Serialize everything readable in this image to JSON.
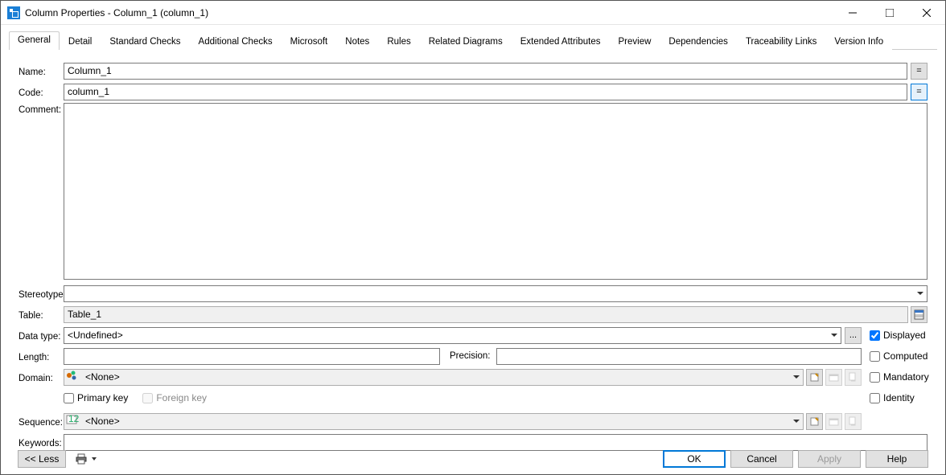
{
  "window": {
    "title": "Column Properties - Column_1 (column_1)"
  },
  "tabs": [
    "General",
    "Detail",
    "Standard Checks",
    "Additional Checks",
    "Microsoft",
    "Notes",
    "Rules",
    "Related Diagrams",
    "Extended Attributes",
    "Preview",
    "Dependencies",
    "Traceability Links",
    "Version Info"
  ],
  "active_tab": "General",
  "labels": {
    "name": "Name:",
    "code": "Code:",
    "comment": "Comment:",
    "stereotype": "Stereotype:",
    "table": "Table:",
    "datatype": "Data type:",
    "length": "Length:",
    "precision": "Precision:",
    "domain": "Domain:",
    "sequence": "Sequence:",
    "keywords": "Keywords:"
  },
  "values": {
    "name": "Column_1",
    "code": "column_1",
    "comment": "",
    "stereotype": "",
    "table": "Table_1",
    "datatype": "<Undefined>",
    "length": "",
    "precision": "",
    "domain": "<None>",
    "sequence": "<None>",
    "keywords": ""
  },
  "checkboxes": {
    "displayed": {
      "label": "Displayed",
      "checked": true
    },
    "computed": {
      "label": "Computed",
      "checked": false
    },
    "mandatory": {
      "label": "Mandatory",
      "checked": false
    },
    "identity": {
      "label": "Identity",
      "checked": false
    },
    "primary_key": {
      "label": "Primary key",
      "checked": false
    },
    "foreign_key": {
      "label": "Foreign key",
      "checked": false,
      "disabled": true
    }
  },
  "buttons": {
    "equal": "=",
    "ellipsis": "...",
    "less": "<< Less",
    "ok": "OK",
    "cancel": "Cancel",
    "apply": "Apply",
    "help": "Help"
  }
}
